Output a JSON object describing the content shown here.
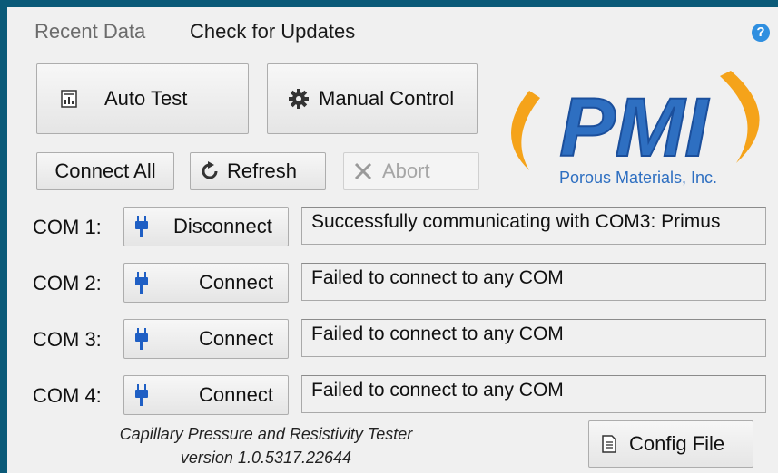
{
  "menu": {
    "recent_data": "Recent Data",
    "check_updates": "Check for Updates",
    "help": "?"
  },
  "toolbar": {
    "auto_test": "Auto Test",
    "manual_control": "Manual Control",
    "connect_all": "Connect All",
    "refresh": "Refresh",
    "abort": "Abort"
  },
  "logo": {
    "text": "PMI",
    "company": "Porous Materials, Inc."
  },
  "ports": [
    {
      "label": "COM 1:",
      "button": "Disconnect",
      "status": "Successfully communicating with COM3: Primus"
    },
    {
      "label": "COM 2:",
      "button": "Connect",
      "status": "Failed to connect to any COM"
    },
    {
      "label": "COM 3:",
      "button": "Connect",
      "status": "Failed to connect to any COM"
    },
    {
      "label": "COM 4:",
      "button": "Connect",
      "status": "Failed to connect to any COM"
    }
  ],
  "footer": {
    "product": "Capillary Pressure and Resistivity Tester",
    "version": "version 1.0.5317.22644"
  },
  "config": {
    "label": "Config File"
  },
  "colors": {
    "background": "#0b5a78",
    "window": "#f0f0f0",
    "logo_blue": "#2e6fc1",
    "logo_orange": "#f5a31a",
    "plug_blue": "#1f5fc4"
  }
}
